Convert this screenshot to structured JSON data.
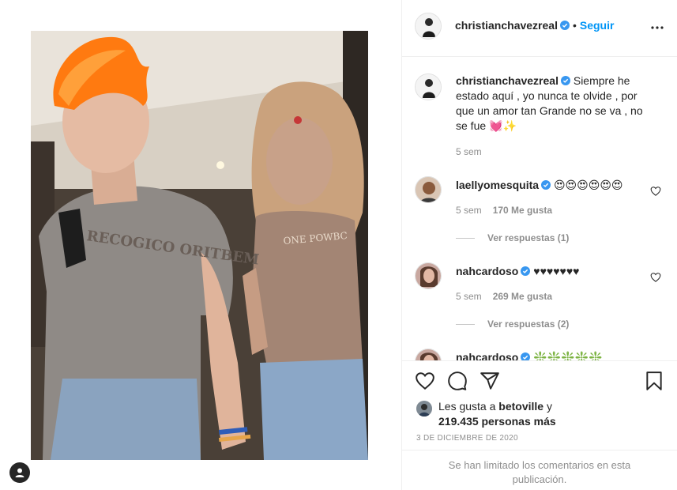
{
  "post": {
    "author": "christianchavezreal",
    "follow_label": "Seguir",
    "separator": "•",
    "photo_shirt_text_left": "RECOGICO ORITBEM",
    "photo_shirt_text_right": "ONE POWBC"
  },
  "caption": {
    "username": "christianchavezreal",
    "text": "Siempre he estado aquí , yo nunca te olvide , por que un amor tan Grande no se va , no se fue 💓✨",
    "age": "5 sem"
  },
  "comments": [
    {
      "username": "laellyomesquita",
      "text": "😍😍😍😍😍😍",
      "age": "5 sem",
      "likes": "170 Me gusta",
      "replies": "Ver respuestas (1)"
    },
    {
      "username": "nahcardoso",
      "text": "♥♥♥♥♥♥♥",
      "age": "5 sem",
      "likes": "269 Me gusta",
      "replies": "Ver respuestas (2)"
    },
    {
      "username": "nahcardoso",
      "text": "❇️❇️❇️❇️❇️"
    }
  ],
  "likes": {
    "prefix": "Les gusta a",
    "user": "betoville",
    "conj": "y",
    "count": "219.435 personas más"
  },
  "date": "3 DE DICIEMBRE DE 2020",
  "limited_comments": "Se han limitado los comentarios en esta publicación.",
  "icons": {
    "verified": "verified-badge-icon",
    "more": "more-options-icon",
    "like": "heart-icon",
    "comment": "comment-icon",
    "share": "send-icon",
    "save": "bookmark-icon",
    "profile": "profile-icon"
  },
  "colors": {
    "accent": "#0095f6",
    "text": "#262626",
    "muted": "#8e8e8e"
  }
}
